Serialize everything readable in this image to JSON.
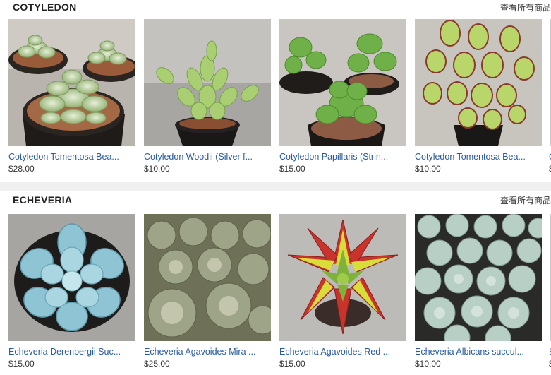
{
  "sections": [
    {
      "title": "COTYLEDON",
      "view_all": "查看所有商品",
      "products": [
        {
          "title": "Cotyledon Tomentosa Bea...",
          "price": "$28.00",
          "image": "cotyledon-tomentosa-plants-photo"
        },
        {
          "title": "Cotyledon Woodii (Silver f...",
          "price": "$10.00",
          "image": "cotyledon-woodii-plant-photo"
        },
        {
          "title": "Cotyledon Papillaris (Strin...",
          "price": "$15.00",
          "image": "cotyledon-papillaris-plants-photo"
        },
        {
          "title": "Cotyledon Tomentosa Bea...",
          "price": "$10.00",
          "image": "cotyledon-tomentosa-closeup-photo"
        }
      ],
      "peek_title": "C",
      "peek_price": "$"
    },
    {
      "title": "ECHEVERIA",
      "view_all": "查看所有商品",
      "products": [
        {
          "title": "Echeveria Derenbergii Suc...",
          "price": "$15.00",
          "image": "echeveria-derenbergii-photo"
        },
        {
          "title": "Echeveria Agavoides Mira ...",
          "price": "$25.00",
          "image": "echeveria-agavoides-mira-photo"
        },
        {
          "title": "Echeveria Agavoides Red ...",
          "price": "$15.00",
          "image": "echeveria-agavoides-red-photo"
        },
        {
          "title": "Echeveria Albicans succul...",
          "price": "$10.00",
          "image": "echeveria-albicans-photo"
        }
      ],
      "peek_title": "E",
      "peek_price": "$"
    }
  ],
  "colors": {
    "link": "#2a5a9e",
    "price": "#333333",
    "page_bg": "#f0f0f0",
    "card_bg": "#ffffff"
  }
}
